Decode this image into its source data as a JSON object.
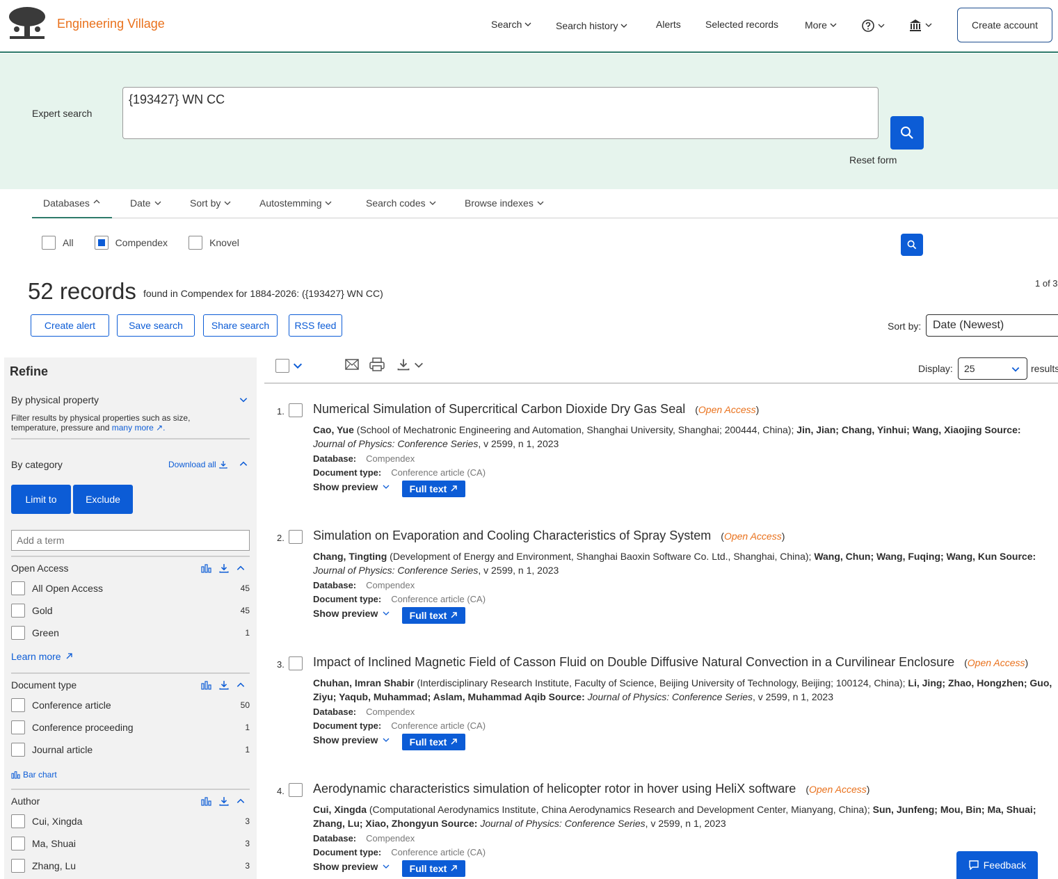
{
  "header": {
    "brand": "Engineering Village",
    "nav": [
      "Search",
      "Search history",
      "Alerts",
      "Selected records",
      "More"
    ],
    "create_account": "Create account"
  },
  "search": {
    "label": "Expert search",
    "query": "{193427} WN CC",
    "reset": "Reset form"
  },
  "tabs": [
    "Databases",
    "Date",
    "Sort by",
    "Autostemming",
    "Search codes",
    "Browse indexes"
  ],
  "databases": [
    {
      "label": "All",
      "checked": false
    },
    {
      "label": "Compendex",
      "checked": true
    },
    {
      "label": "Knovel",
      "checked": false
    }
  ],
  "summary": {
    "count": "52 records",
    "found_in": "found in Compendex for 1884-2026: ({193427} WN CC)",
    "page_of": "1 of 3"
  },
  "actions": [
    "Create alert",
    "Save search",
    "Share search",
    "RSS feed"
  ],
  "sort": {
    "label": "Sort by:",
    "value": "Date (Newest)"
  },
  "display": {
    "label": "Display:",
    "value": "25",
    "suffix": "results"
  },
  "refine": {
    "title": "Refine",
    "physical": {
      "title": "By physical property",
      "desc": "Filter results by physical properties such as size, temperature, pressure and",
      "link": "many more"
    },
    "category": {
      "title": "By category",
      "download_all": "Download all",
      "limit_to": "Limit to",
      "exclude": "Exclude",
      "add_term": "Add a term"
    },
    "open_access": {
      "title": "Open Access",
      "items": [
        {
          "label": "All Open Access",
          "count": "45"
        },
        {
          "label": "Gold",
          "count": "45"
        },
        {
          "label": "Green",
          "count": "1"
        }
      ],
      "learn_more": "Learn more"
    },
    "doc_type": {
      "title": "Document type",
      "items": [
        {
          "label": "Conference article",
          "count": "50"
        },
        {
          "label": "Conference proceeding",
          "count": "1"
        },
        {
          "label": "Journal article",
          "count": "1"
        }
      ],
      "bar_chart": "Bar chart"
    },
    "author": {
      "title": "Author",
      "items": [
        {
          "label": "Cui, Xingda",
          "count": "3"
        },
        {
          "label": "Ma, Shuai",
          "count": "3"
        },
        {
          "label": "Zhang, Lu",
          "count": "3"
        }
      ]
    }
  },
  "results": [
    {
      "num": "1.",
      "title": "Numerical Simulation of Supercritical Carbon Dioxide Dry Gas Seal",
      "oa": "Open Access",
      "first_author": "Cao, Yue",
      "affil": " (School of Mechatronic Engineering and Automation, Shanghai University, Shanghai; 200444, China); ",
      "other_authors": "Jin, Jian; Chang, Yinhui; Wang, Xiaojing Source: ",
      "source": "Journal of Physics: Conference Series",
      "source_tail": ", v 2599, n 1, 2023",
      "database": "Compendex",
      "doctype": "Conference article (CA)"
    },
    {
      "num": "2.",
      "title": "Simulation on Evaporation and Cooling Characteristics of Spray System",
      "oa": "Open Access",
      "first_author": "Chang, Tingting",
      "affil": " (Development of Energy and Environment, Shanghai Baoxin Software Co. Ltd., Shanghai, China); ",
      "other_authors": "Wang, Chun; Wang, Fuqing; Wang, Kun Source: ",
      "source": "Journal of Physics: Conference Series",
      "source_tail": ", v 2599, n 1, 2023",
      "database": "Compendex",
      "doctype": "Conference article (CA)"
    },
    {
      "num": "3.",
      "title": "Impact of Inclined Magnetic Field of Casson Fluid on Double Diffusive Natural Convection in a Curvilinear Enclosure",
      "oa": "Open Access",
      "first_author": "Chuhan, Imran Shabir",
      "affil": " (Interdisciplinary Research Institute, Faculty of Science, Beijing University of Technology, Beijing; 100124, China); ",
      "other_authors": "Li, Jing; Zhao, Hongzhen; Guo, Ziyu; Yaqub, Muhammad; Aslam, Muhammad Aqib Source: ",
      "source": "Journal of Physics: Conference Series",
      "source_tail": ", v 2599, n 1, 2023",
      "database": "Compendex",
      "doctype": "Conference article (CA)"
    },
    {
      "num": "4.",
      "title": "Aerodynamic characteristics simulation of helicopter rotor in hover using HeliX software",
      "oa": "Open Access",
      "first_author": "Cui, Xingda",
      "affil": " (Computational Aerodynamics Institute, China Aerodynamics Research and Development Center, Mianyang, China); ",
      "other_authors": "Sun, Junfeng; Mou, Bin; Ma, Shuai; Zhang, Lu; Xiao, Zhongyun Source: ",
      "source": "Journal of Physics: Conference Series",
      "source_tail": ", v 2599, n 1, 2023",
      "database": "Compendex",
      "doctype": "Conference article (CA)"
    }
  ],
  "labels": {
    "database": "Database:",
    "doctype": "Document type:",
    "show_preview": "Show preview",
    "full_text": "Full text"
  },
  "feedback": "Feedback",
  "colors": {
    "accent": "#0c5cd6",
    "brand": "#e9711c",
    "band": "#e6f4ed"
  }
}
